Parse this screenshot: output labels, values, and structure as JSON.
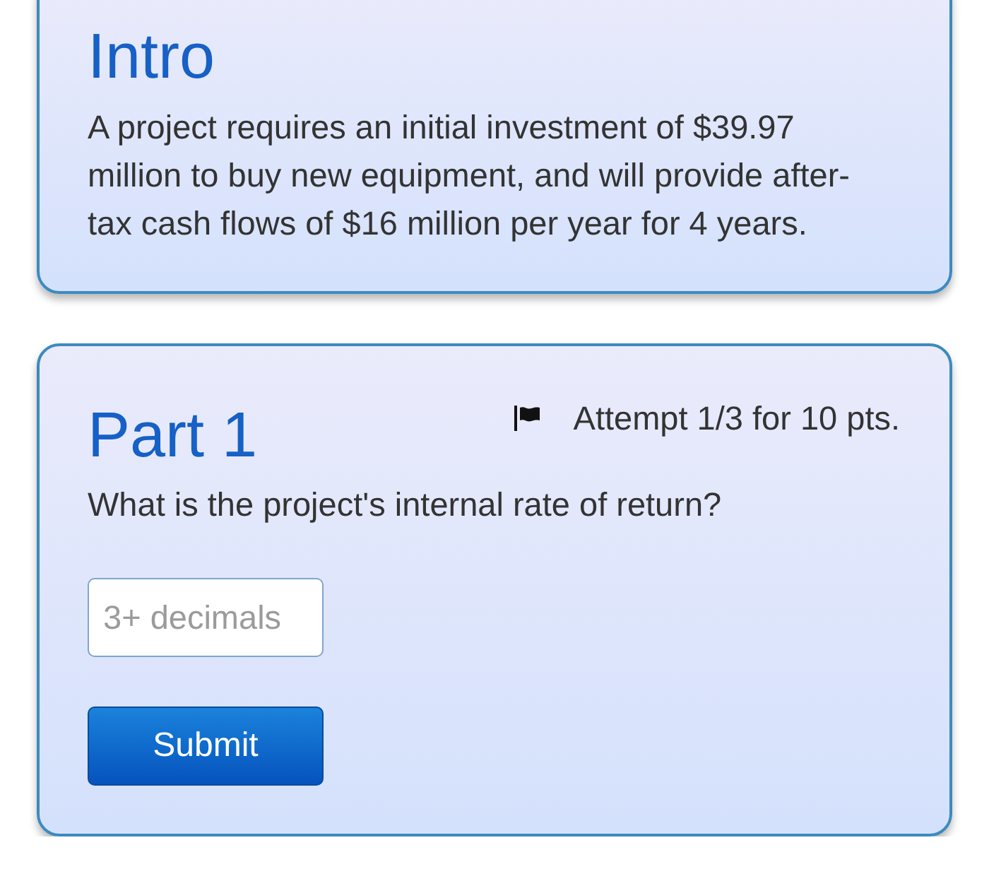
{
  "intro": {
    "title": "Intro",
    "text": "A project requires an initial investment of $39.97 million to buy new equipment, and will provide after-tax cash flows of $16 million per year for 4 years."
  },
  "part": {
    "title": "Part 1",
    "attempt": "Attempt 1/3 for 10 pts.",
    "question": "What is the project's internal rate of return?",
    "answer": {
      "placeholder": "3+ decimals"
    },
    "submit": "Submit"
  }
}
